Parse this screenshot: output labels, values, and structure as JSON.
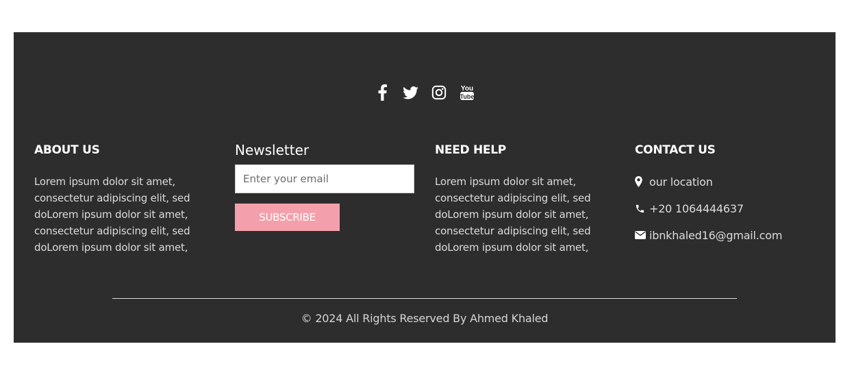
{
  "social": {
    "icons": [
      "facebook-icon",
      "twitter-icon",
      "instagram-icon",
      "youtube-icon"
    ]
  },
  "about": {
    "heading": "ABOUT US",
    "text": "Lorem ipsum dolor sit amet, consectetur adipiscing elit, sed doLorem ipsum dolor sit amet, consectetur adipiscing elit, sed doLorem ipsum dolor sit amet,"
  },
  "newsletter": {
    "heading": "Newsletter",
    "email_placeholder": "Enter your email",
    "subscribe_label": "SUBSCRIBE",
    "button_color": "#f4a0ac"
  },
  "help": {
    "heading": "NEED HELP",
    "text": "Lorem ipsum dolor sit amet, consectetur adipiscing elit, sed doLorem ipsum dolor sit amet, consectetur adipiscing elit, sed doLorem ipsum dolor sit amet,"
  },
  "contact": {
    "heading": "CONTACT US",
    "location": "our location",
    "phone": "+20 1064444637",
    "email": "ibnkhaled16@gmail.com"
  },
  "copyright": "© 2024 All Rights Reserved By Ahmed Khaled",
  "colors": {
    "footer_bg": "#2d2d2d",
    "accent": "#f4a0ac"
  }
}
